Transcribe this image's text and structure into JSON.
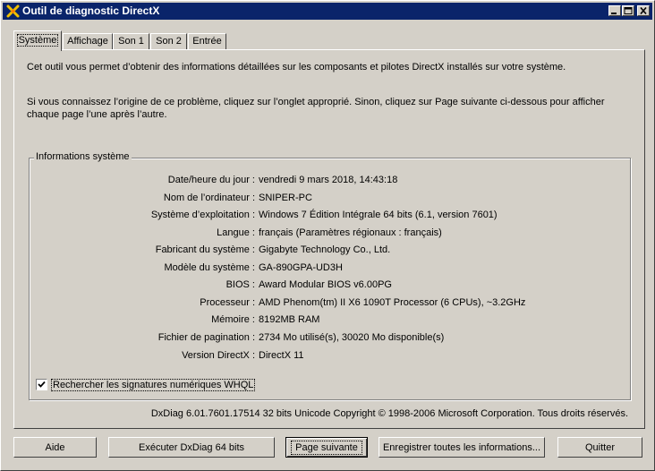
{
  "window": {
    "title": "Outil de diagnostic DirectX",
    "colors": {
      "titlebar": "#0a246a",
      "face": "#d4d0c8"
    }
  },
  "tabs": [
    {
      "label": "Système",
      "active": true
    },
    {
      "label": "Affichage",
      "active": false
    },
    {
      "label": "Son 1",
      "active": false
    },
    {
      "label": "Son 2",
      "active": false
    },
    {
      "label": "Entrée",
      "active": false
    }
  ],
  "intro": {
    "line1": "Cet outil vous permet d’obtenir des informations détaillées sur les composants et pilotes DirectX installés sur votre système.",
    "line2": "Si vous connaissez l’origine de ce problème, cliquez sur l’onglet approprié. Sinon, cliquez sur Page suivante ci-dessous pour afficher chaque page l’une après l’autre."
  },
  "system_info": {
    "group_title": "Informations système",
    "rows": [
      {
        "label": "Date/heure du jour :",
        "value": "vendredi 9 mars 2018, 14:43:18"
      },
      {
        "label": "Nom de l’ordinateur :",
        "value": "SNIPER-PC"
      },
      {
        "label": "Système d’exploitation :",
        "value": "Windows 7 Édition Intégrale 64 bits (6.1, version 7601)"
      },
      {
        "label": "Langue :",
        "value": "français (Paramètres régionaux : français)"
      },
      {
        "label": "Fabricant du système :",
        "value": "Gigabyte Technology Co., Ltd."
      },
      {
        "label": "Modèle du système :",
        "value": "GA-890GPA-UD3H"
      },
      {
        "label": "BIOS :",
        "value": "Award Modular BIOS v6.00PG"
      },
      {
        "label": "Processeur :",
        "value": "AMD Phenom(tm) II X6 1090T Processor (6 CPUs), ~3.2GHz"
      },
      {
        "label": "Mémoire :",
        "value": "8192MB RAM"
      },
      {
        "label": "Fichier de pagination :",
        "value": "2734 Mo utilisé(s), 30020 Mo disponible(s)"
      },
      {
        "label": "Version DirectX :",
        "value": "DirectX 11"
      }
    ]
  },
  "whql_checkbox": {
    "label": "Rechercher les signatures numériques WHQL",
    "checked": true
  },
  "footer": "DxDiag 6.01.7601.17514 32 bits Unicode Copyright © 1998-2006 Microsoft Corporation. Tous droits réservés.",
  "buttons": {
    "help": "Aide",
    "run64": "Exécuter DxDiag 64 bits",
    "next": "Page suivante",
    "save": "Enregistrer toutes les informations...",
    "quit": "Quitter"
  }
}
